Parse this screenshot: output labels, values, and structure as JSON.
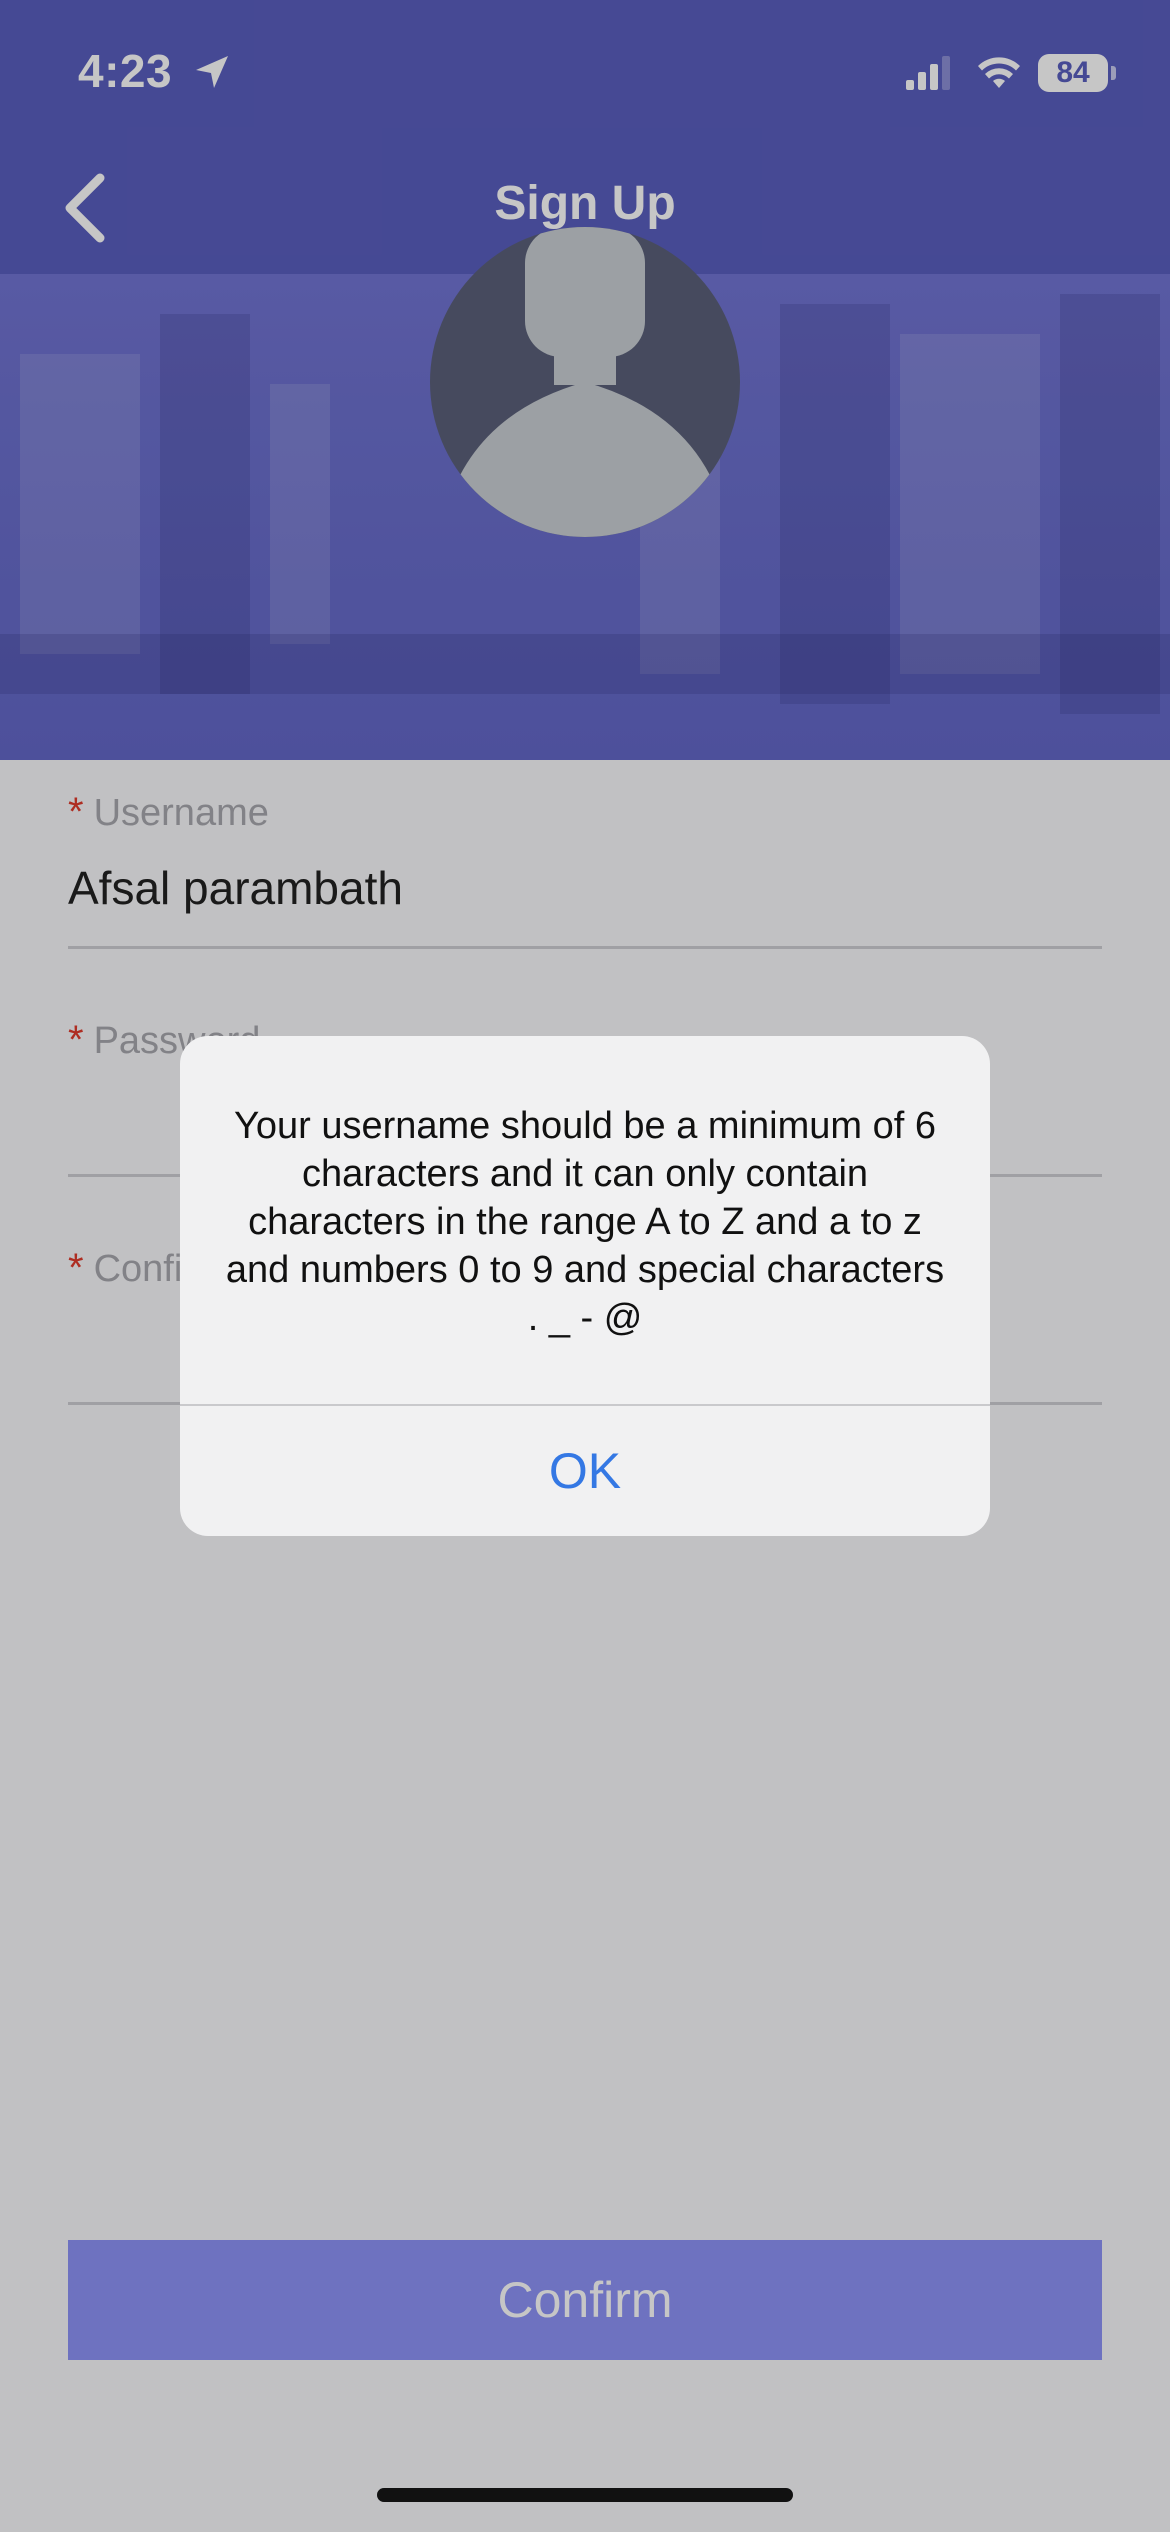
{
  "status_bar": {
    "time": "4:23",
    "battery": "84",
    "icons": [
      "location-arrow-icon",
      "cellular-signal-icon",
      "wifi-icon",
      "battery-icon"
    ]
  },
  "header": {
    "title": "Sign Up",
    "back_icon": "chevron-left-icon"
  },
  "banner": {
    "avatar_icon": "user-silhouette-icon"
  },
  "form": {
    "username": {
      "label": "Username",
      "required_mark": "*",
      "value": "Afsal parambath"
    },
    "password": {
      "label": "Password",
      "required_mark": "*",
      "value": ""
    },
    "confirm_password": {
      "label": "Confirm Password",
      "required_mark": "*",
      "value": ""
    }
  },
  "confirm_button": {
    "label": "Confirm"
  },
  "alert": {
    "message": "Your username should be a minimum of 6 characters and it can only contain characters in the range A to Z and a to z and numbers 0 to 9 and special characters . _ - @",
    "ok_label": "OK"
  },
  "colors": {
    "brand": "#5a5ebf",
    "button": "#8e93f7",
    "required": "#e03b2d",
    "alert_action": "#3478e4"
  }
}
